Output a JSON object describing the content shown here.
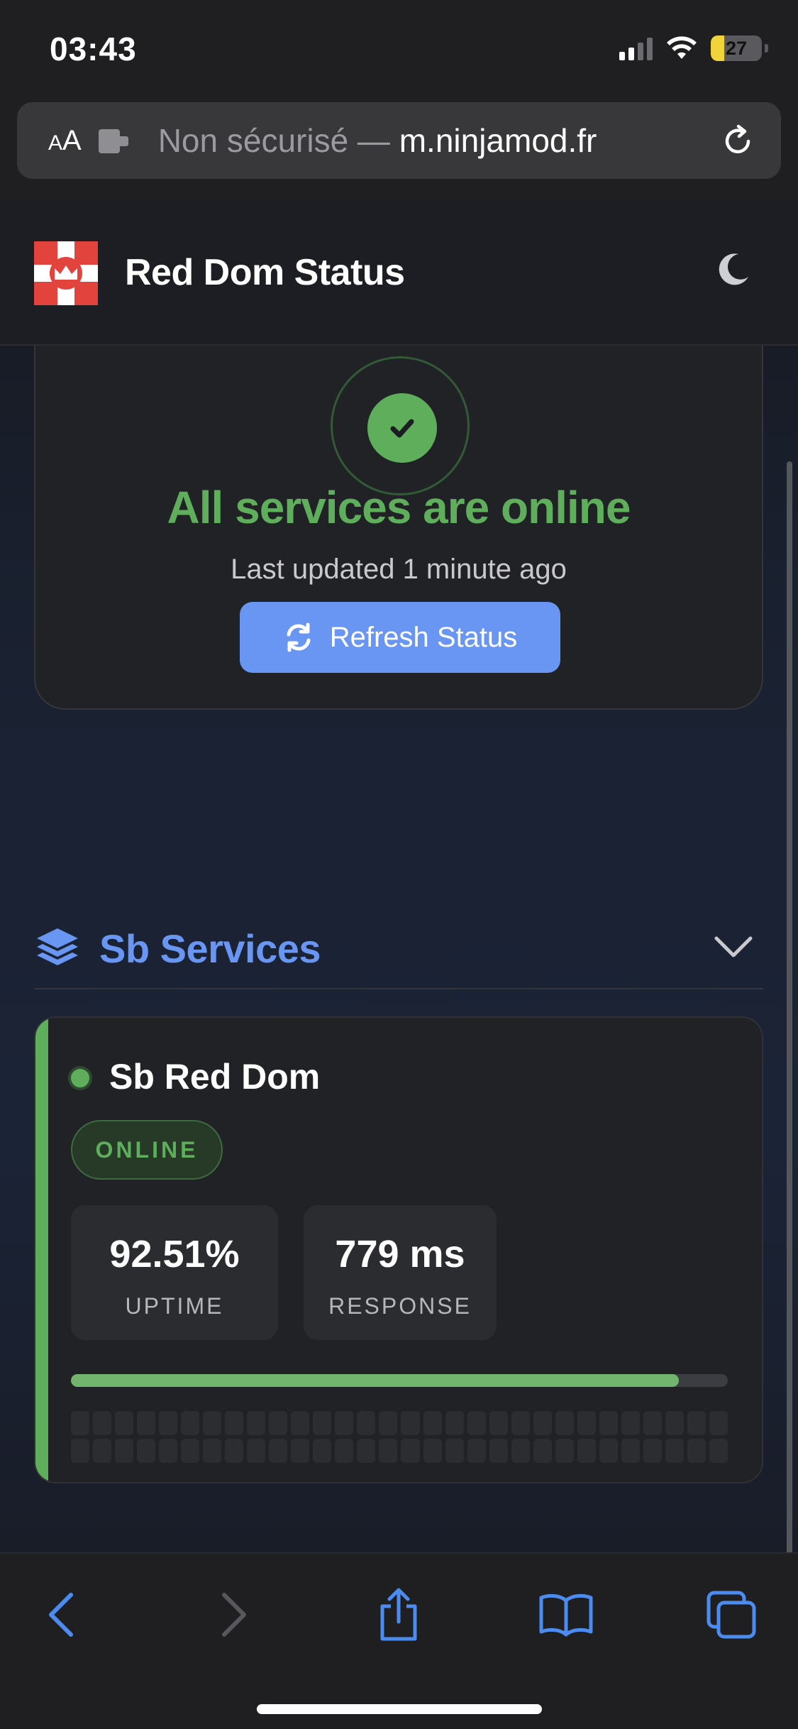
{
  "status_bar": {
    "time": "03:43",
    "battery_percent": "27",
    "battery_level": 0.27,
    "signal_bars": 2
  },
  "browser": {
    "aa_label": "AA",
    "url_prefix": "Non sécurisé — ",
    "url_domain": "m.ninjamod.fr",
    "reload_icon": "reload-icon",
    "extension_icon": "puzzle-icon"
  },
  "site": {
    "title": "Red Dom Status",
    "theme_icon": "moon-icon",
    "logo_color": "#e2433c"
  },
  "overall_status": {
    "title": "All services are online",
    "last_updated": "Last updated 1 minute ago",
    "refresh_label": "Refresh Status",
    "color": "#5fae5c"
  },
  "group": {
    "title": "Sb Services",
    "icon": "layers-icon",
    "expanded": true,
    "color": "#6896f2"
  },
  "services": [
    {
      "name": "Sb Red Dom",
      "status": "ONLINE",
      "uptime": "92.51%",
      "uptime_label": "UPTIME",
      "uptime_fraction": 0.9251,
      "response": "779 ms",
      "response_label": "RESPONSE"
    }
  ],
  "toolbar": {
    "icons": [
      "back-icon",
      "forward-icon",
      "share-icon",
      "bookmarks-icon",
      "tabs-icon"
    ],
    "accent": "#4c8cf0"
  }
}
